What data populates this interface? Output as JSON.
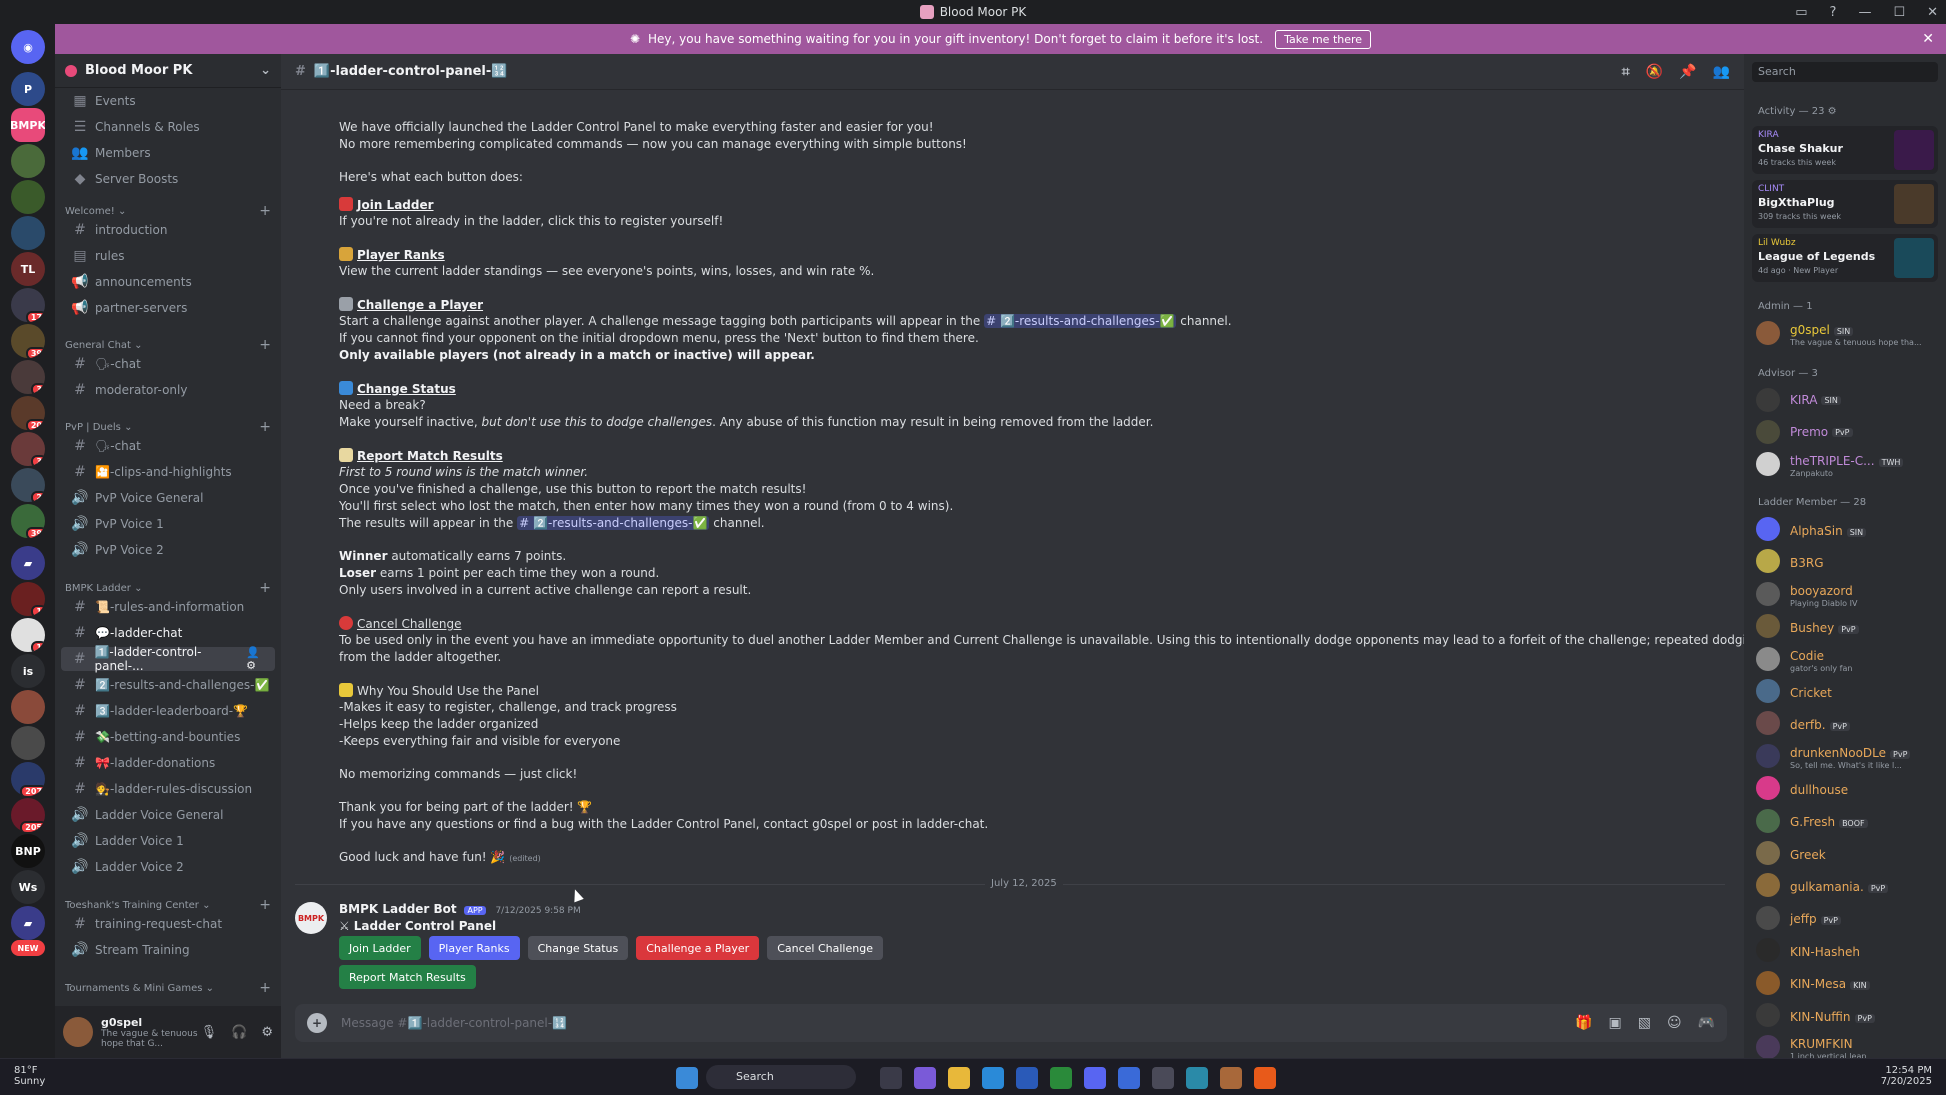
{
  "window": {
    "title": "Blood Moor PK"
  },
  "banner": {
    "text": "Hey, you have something waiting for you in your gift inventory! Don't forget to claim it before it's lost.",
    "button": "Take me there"
  },
  "server": {
    "name": "Blood Moor PK"
  },
  "sidebar": {
    "top": [
      "Events",
      "Channels & Roles",
      "Members",
      "Server Boosts"
    ],
    "categories": [
      "Welcome!",
      "General Chat",
      "PvP | Duels",
      "BMPK Ladder",
      "Toeshank's Training Center",
      "Tournaments & Mini Games"
    ],
    "welcome": [
      "introduction",
      "rules",
      "announcements",
      "partner-servers"
    ],
    "general": [
      "🗣-chat",
      "moderator-only"
    ],
    "pvp": [
      "🗣-chat",
      "🎦-clips-and-highlights",
      "PvP Voice General",
      "PvP Voice 1",
      "PvP Voice 2"
    ],
    "ladder": [
      "📜-rules-and-information",
      "💬-ladder-chat",
      "1️⃣-ladder-control-panel-...",
      "2️⃣-results-and-challenges-✅",
      "3️⃣-ladder-leaderboard-🏆",
      "💸-betting-and-bounties",
      "🎀-ladder-donations",
      "🧑‍⚖️-ladder-rules-discussion",
      "Ladder Voice General",
      "Ladder Voice 1",
      "Ladder Voice 2"
    ],
    "training": [
      "training-request-chat",
      "Stream Training"
    ]
  },
  "user": {
    "name": "g0spel",
    "status": "The vague & tenuous hope that G..."
  },
  "channel": {
    "name": "1️⃣-ladder-control-panel-🔢",
    "composer_placeholder": "Message #1️⃣-ladder-control-panel-🔢"
  },
  "message": {
    "l1": "We have officially launched the Ladder Control Panel to make everything faster and easier for you!",
    "l2": "No more remembering complicated commands — now you can manage everything with simple buttons!",
    "l3": "Here's what each button does:",
    "join_h": "Join Ladder",
    "join_1": "If you're not already in the ladder, click this to register yourself!",
    "ranks_h": "Player Ranks",
    "ranks_1": "View the current ladder standings — see everyone's points, wins, losses, and win rate %.",
    "chal_h": "Challenge a Player",
    "chal_1a": "Start a challenge against another player. A challenge message tagging both participants will appear in the",
    "chal_mention": "# 2️⃣-results-and-challenges-✅",
    "chal_1b": "channel.",
    "chal_2": "If you cannot find your opponent on the initial dropdown menu, press the 'Next' button to find them there.",
    "chal_3": "Only available players (not already in a match or inactive) will appear.",
    "status_h": "Change Status",
    "status_1": "Need a break?",
    "status_2a": "Make yourself inactive, ",
    "status_2i": "but don't use this to dodge challenges",
    "status_2b": ". Any abuse of this function may result in being removed from the ladder.",
    "report_h": "Report Match Results",
    "report_1": "First to 5 round wins is the match winner.",
    "report_2": "Once you've finished a challenge, use this button to report the match results!",
    "report_3": "You'll first select who lost the match, then enter how many times they won a round (from 0 to 4 wins).",
    "report_4a": "The results will appear in the",
    "report_4b": "channel.",
    "winner_b": "Winner",
    "winner_t": " automatically earns 7 points.",
    "loser_b": "Loser",
    "loser_t": " earns 1 point per each time they won a round.",
    "only": "Only users involved in a current active challenge can report a result.",
    "cancel_h": "Cancel Challenge",
    "cancel_1": "To be used only in the event you have an immediate opportunity to duel another Ladder Member and Current Challenge is unavailable. Using this to intentionally dodge opponents may lead to a forfeit of the challenge; repeated dodging may result in being removed",
    "cancel_2": "from the ladder altogether.",
    "why_h": "Why You Should Use the Panel",
    "why_1": "-Makes it easy to register, challenge, and track progress",
    "why_2": "-Helps keep the ladder organized",
    "why_3": "-Keeps everything fair and visible for everyone",
    "nomem": "No memorizing commands — just click!",
    "thanks": "Thank you for being part of the ladder! 🏆",
    "contact": "If you have any questions or find a bug with the Ladder Control Panel, contact g0spel or post in ladder-chat.",
    "luck": "Good luck and have fun! 🎉",
    "edited": "(edited)"
  },
  "date_sep": "July 12, 2025",
  "bot": {
    "name": "BMPK Ladder Bot",
    "tag": "APP",
    "time": "7/12/2025 9:58 PM",
    "title": "Ladder Control Panel",
    "buttons": [
      "Join Ladder",
      "Player Ranks",
      "Change Status",
      "Challenge a Player",
      "Cancel Challenge",
      "Report Match Results"
    ]
  },
  "members": {
    "search": "Search",
    "activity_header": "Activity — 23",
    "activity": [
      {
        "user": "KIRA",
        "title": "Chase Shakur",
        "sub": "46 tracks this week"
      },
      {
        "user": "CLINT",
        "title": "BigXthaPlug",
        "sub": "309 tracks this week"
      },
      {
        "user": "Lil Wubz",
        "title": "League of Legends",
        "sub": "4d ago · New Player"
      }
    ],
    "admin_header": "Admin — 1",
    "admin": [
      {
        "name": "g0spel",
        "tag": "SIN",
        "sub": "The vague & tenuous hope tha..."
      }
    ],
    "advisor_header": "Advisor — 3",
    "advisor": [
      {
        "name": "KIRA",
        "tag": "SIN",
        "sub": ""
      },
      {
        "name": "Premo",
        "tag": "PvP",
        "sub": ""
      },
      {
        "name": "theTRIPLE-C...",
        "tag": "TWH",
        "sub": "Zanpakuto"
      }
    ],
    "ladder_header": "Ladder Member — 28",
    "ladder": [
      {
        "name": "AlphaSin",
        "tag": "SIN",
        "sub": ""
      },
      {
        "name": "B3RG",
        "tag": "",
        "sub": ""
      },
      {
        "name": "booyazord",
        "tag": "",
        "sub": "Playing Diablo IV"
      },
      {
        "name": "Bushey",
        "tag": "PvP",
        "sub": ""
      },
      {
        "name": "Codie",
        "tag": "",
        "sub": "gator's only fan"
      },
      {
        "name": "Cricket",
        "tag": "",
        "sub": ""
      },
      {
        "name": "derfb.",
        "tag": "PvP",
        "sub": ""
      },
      {
        "name": "drunkenNooDLe",
        "tag": "PvP",
        "sub": "So, tell me. What's it like l..."
      },
      {
        "name": "dullhouse",
        "tag": "",
        "sub": ""
      },
      {
        "name": "G.Fresh",
        "tag": "BOOF",
        "sub": ""
      },
      {
        "name": "Greek",
        "tag": "",
        "sub": ""
      },
      {
        "name": "gulkamania.",
        "tag": "PvP",
        "sub": ""
      },
      {
        "name": "jeffp",
        "tag": "PvP",
        "sub": ""
      },
      {
        "name": "KIN-Hasheh",
        "tag": "",
        "sub": ""
      },
      {
        "name": "KIN-Mesa",
        "tag": "KIN",
        "sub": ""
      },
      {
        "name": "KIN-Nuffin",
        "tag": "PvP",
        "sub": ""
      },
      {
        "name": "KRUMFKIN",
        "tag": "",
        "sub": "1 inch vertical leap"
      }
    ]
  },
  "taskbar": {
    "weather_temp": "81°F",
    "weather_desc": "Sunny",
    "search": "Search",
    "time": "12:54 PM",
    "date": "7/20/2025"
  },
  "guild_badges": [
    "17",
    "39",
    "3",
    "20",
    "3",
    "2",
    "39",
    "1",
    "1",
    "207",
    "205"
  ],
  "guild_labels": [
    "BMPK",
    "is",
    "Ws",
    "NEW"
  ]
}
